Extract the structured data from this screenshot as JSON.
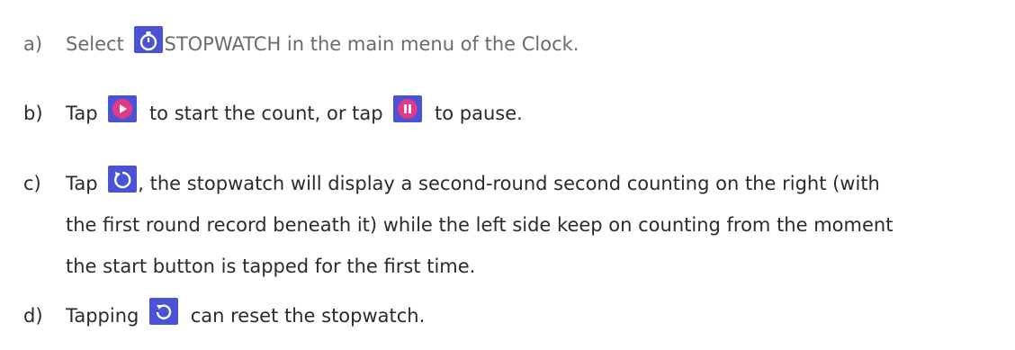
{
  "items": [
    {
      "marker": "a)",
      "parts": [
        "Select",
        "STOPWATCH in the main menu of the Clock."
      ],
      "icon": "stopwatch-icon"
    },
    {
      "marker": "b)",
      "parts": [
        "Tap",
        "to start the count, or tap",
        "to pause."
      ],
      "icons": [
        "start-icon",
        "pause-icon"
      ]
    },
    {
      "marker": "c)",
      "parts": [
        "Tap",
        ", the stopwatch will display a second-round second counting on the right (with"
      ],
      "line2": "the first round record beneath it) while the left side keep on counting from the moment",
      "line3": "the start button is tapped for the first time.",
      "icon": "lap-icon"
    },
    {
      "marker": "d)",
      "parts": [
        "Tapping",
        "can reset the stopwatch."
      ],
      "icon": "reset-icon"
    }
  ],
  "colors": {
    "icon_bg": "#4a52d6",
    "button_pink": "#e23a86",
    "icon_fg": "#ffffff"
  }
}
